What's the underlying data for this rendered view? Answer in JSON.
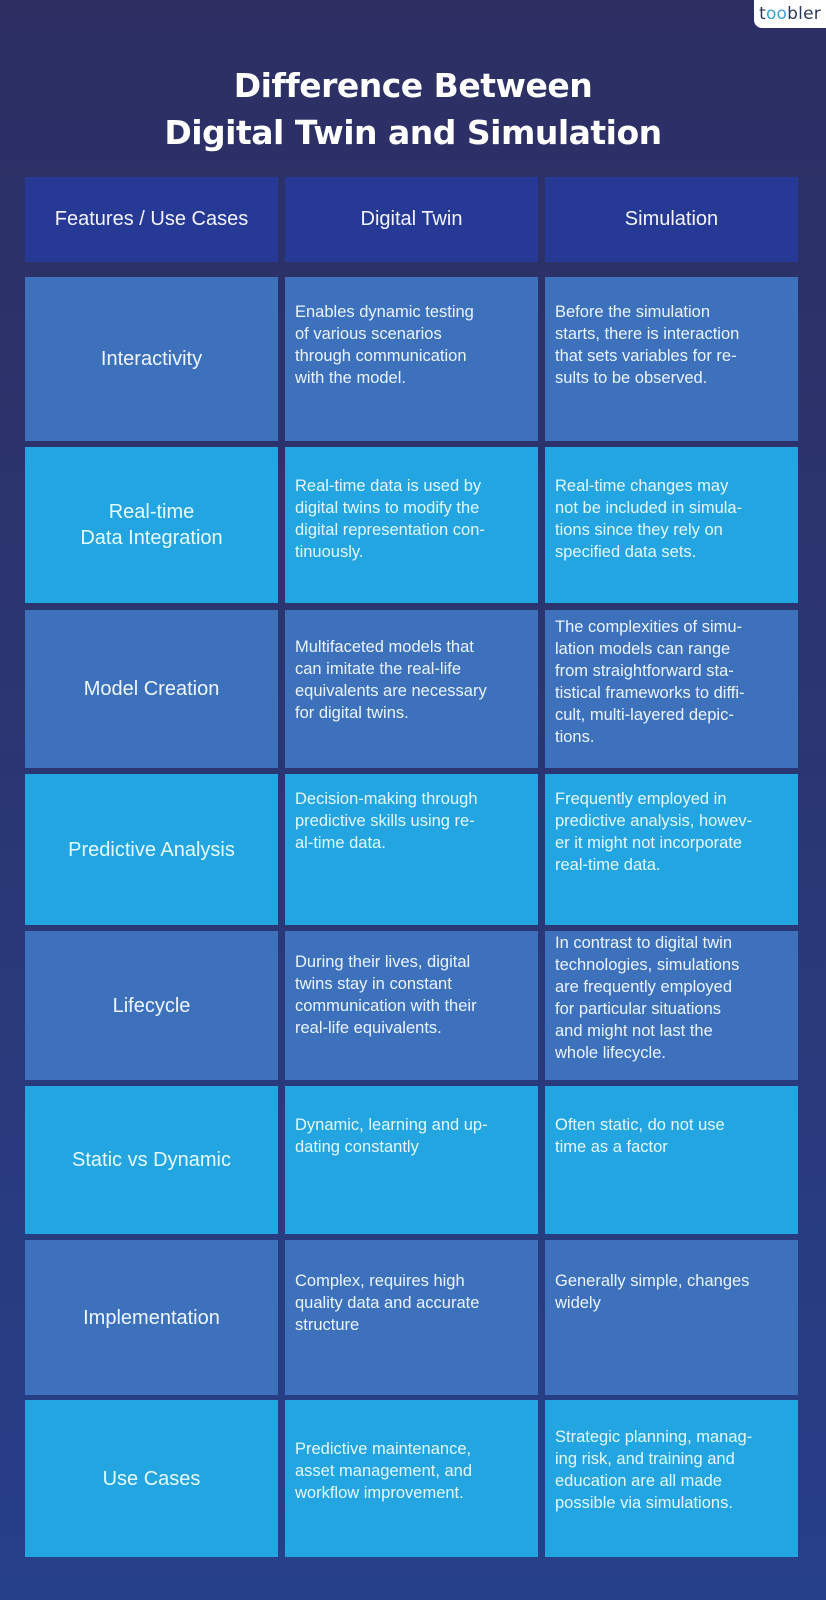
{
  "brand": {
    "logo_prefix": "t",
    "logo_oo": "oo",
    "logo_suffix": "bler"
  },
  "title": {
    "line1": "Difference Between",
    "line2": "Digital Twin and Simulation"
  },
  "table": {
    "headers": [
      "Features / Use Cases",
      "Digital Twin",
      "Simulation"
    ],
    "rows": [
      {
        "feature": "Interactivity",
        "digital_twin": "Enables dynamic testing\nof various scenarios\nthrough communication\nwith the model.",
        "simulation": "Before the simulation\nstarts, there is interaction\nthat sets variables for re-\nsults to be observed."
      },
      {
        "feature": "Real-time\nData Integration",
        "digital_twin": "Real-time data is used by\ndigital twins to modify the\ndigital representation con-\ntinuously.",
        "simulation": "Real-time changes may\nnot be included in simula-\ntions since they rely on\nspecified data sets."
      },
      {
        "feature": "Model Creation",
        "digital_twin": "Multifaceted models that\ncan imitate the real-life\nequivalents are necessary\nfor digital twins.",
        "simulation": "The complexities of simu-\nlation models can range\nfrom straightforward sta-\ntistical frameworks to diffi-\ncult, multi-layered depic-\ntions."
      },
      {
        "feature": "Predictive Analysis",
        "digital_twin": "Decision-making through\npredictive skills using re-\nal-time data.",
        "simulation": "Frequently employed in\npredictive analysis, howev-\ner it might not incorporate\nreal-time data."
      },
      {
        "feature": "Lifecycle",
        "digital_twin": "During their lives, digital\ntwins stay in constant\ncommunication with their\nreal-life equivalents.",
        "simulation": "In contrast to digital twin\ntechnologies, simulations\nare frequently employed\nfor particular situations\nand might not last the\nwhole lifecycle."
      },
      {
        "feature": "Static vs Dynamic",
        "digital_twin": "Dynamic, learning and up-\ndating constantly",
        "simulation": "Often static, do not use\ntime as a factor"
      },
      {
        "feature": "Implementation",
        "digital_twin": "Complex, requires high\nquality data and accurate\nstructure",
        "simulation": "Generally simple, changes\nwidely"
      },
      {
        "feature": "Use Cases",
        "digital_twin": "Predictive maintenance,\nasset management, and\nworkflow improvement.",
        "simulation": "Strategic planning, manag-\ning risk, and training and\neducation are all made\npossible via simulations."
      }
    ]
  },
  "colors": {
    "background": "#2b3570",
    "header_cell": "#263a95",
    "row_dark": "#3d71bb",
    "row_light": "#22a5e0",
    "logo_accent": "#3aa0d8"
  }
}
